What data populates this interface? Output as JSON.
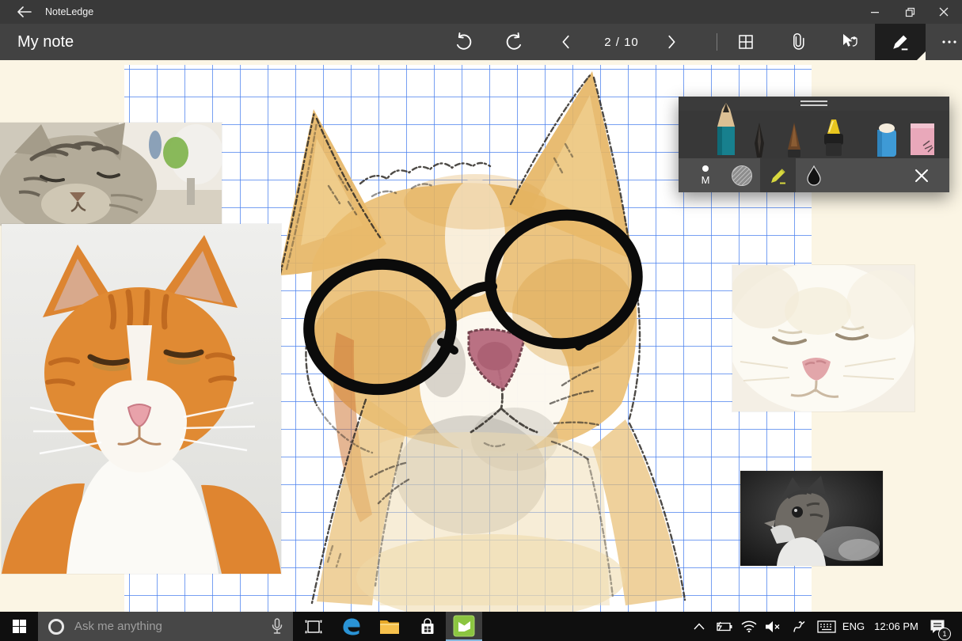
{
  "app": {
    "title": "NoteLedge"
  },
  "toolbar": {
    "note_title": "My note",
    "page_indicator": "2 / 10",
    "buttons": [
      "undo",
      "redo",
      "previous-page",
      "next-page",
      "grid-view",
      "attachment",
      "select",
      "pen",
      "more"
    ]
  },
  "pen_popup": {
    "size_label": "M",
    "tools": [
      "teal-pencil",
      "ink-pen",
      "brush",
      "yellow-marker",
      "eraser",
      "pink-pastel"
    ],
    "actions": [
      "stroke-size",
      "texture",
      "pencil-mode",
      "water-blend",
      "close"
    ]
  },
  "note_content": {
    "drawing": "watercolor cat wearing round black doodle glasses on blue grid paper",
    "photos": [
      "grey-tabby-photo",
      "orange-white-cat-photo",
      "white-fluffy-cat-photo",
      "black-and-white-cat-photo"
    ]
  },
  "taskbar": {
    "search_placeholder": "Ask me anything",
    "apps": [
      "task-view",
      "edge",
      "file-explorer",
      "store",
      "noteledge-active"
    ],
    "language": "ENG",
    "time": "12:06 PM",
    "notification_count": "1"
  },
  "colors": {
    "titlebar": "#393939",
    "toolbar": "#424242",
    "pen_active_bg": "#1e1e1e",
    "desktop_cream": "#fbf5e4",
    "grid_blue": "#4a80ee",
    "popup_bg": "#383838",
    "popup_bottom": "#4e4e4e",
    "taskbar": "#0f0f0f",
    "noteledge_green": "#8bc540",
    "drawing_tan": "#e6b563",
    "nose_rose": "#b76a7e"
  }
}
